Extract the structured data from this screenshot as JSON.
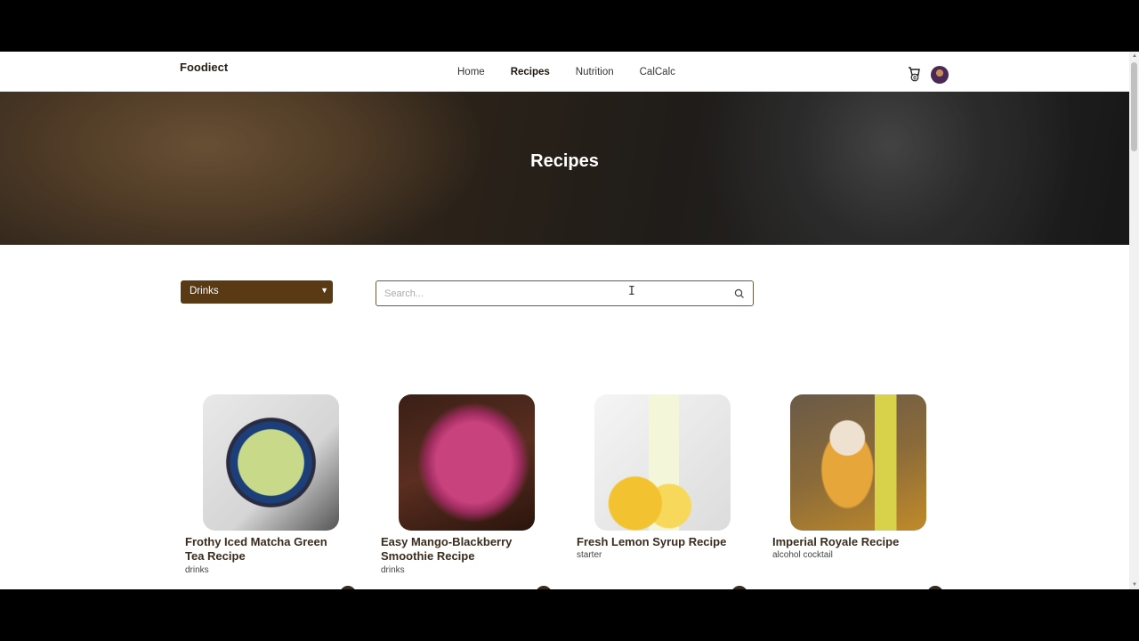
{
  "brand": "Foodiect",
  "nav": {
    "items": [
      "Home",
      "Recipes",
      "Nutrition",
      "CalCalc"
    ],
    "active": "Recipes"
  },
  "cart": {
    "icon": "cart-icon",
    "count": "0"
  },
  "avatar": {
    "icon": "user-avatar"
  },
  "hero": {
    "title": "Recipes"
  },
  "filter": {
    "selected": "Drinks"
  },
  "search": {
    "placeholder": "Search..."
  },
  "recipes": [
    {
      "title": "Frothy Iced Matcha Green Tea Recipe",
      "category": "drinks"
    },
    {
      "title": "Easy Mango-Blackberry Smoothie Recipe",
      "category": "drinks"
    },
    {
      "title": "Fresh Lemon Syrup Recipe",
      "category": "starter"
    },
    {
      "title": "Imperial Royale Recipe",
      "category": "alcohol cocktail"
    }
  ],
  "colors": {
    "accent": "#5a3a14",
    "title": "#3a2c1e"
  }
}
